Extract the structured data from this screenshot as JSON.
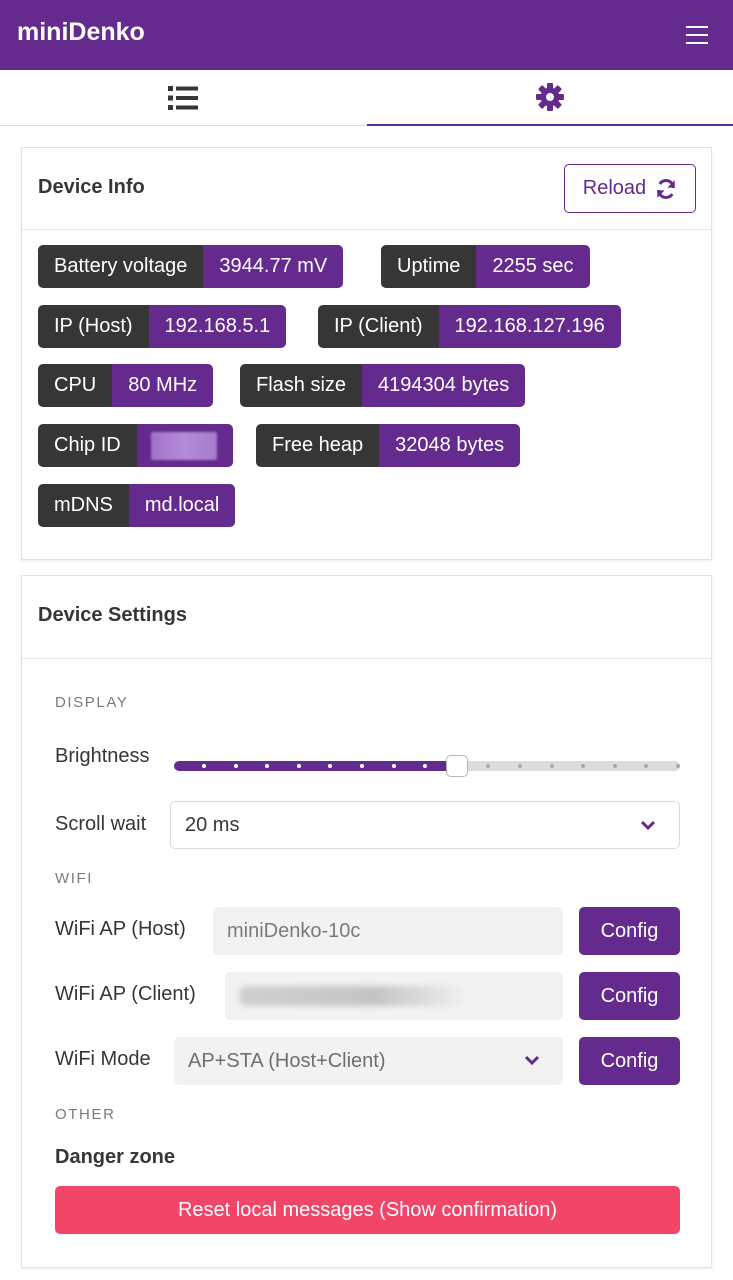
{
  "navbar": {
    "brand": "miniDenko",
    "menu_icon": "hamburger-menu-icon"
  },
  "tabs": [
    {
      "icon": "list-icon",
      "active": false
    },
    {
      "icon": "gear-icon",
      "active": true
    }
  ],
  "device_info": {
    "title": "Device Info",
    "reload_label": "Reload",
    "reload_icon": "refresh-icon",
    "items": [
      {
        "key": "Battery voltage",
        "value": "3944.77 mV"
      },
      {
        "key": "Uptime",
        "value": "2255 sec"
      },
      {
        "key": "IP (Host)",
        "value": "192.168.5.1"
      },
      {
        "key": "IP (Client)",
        "value": "192.168.127.196"
      },
      {
        "key": "CPU",
        "value": "80 MHz"
      },
      {
        "key": "Flash size",
        "value": "4194304 bytes"
      },
      {
        "key": "Chip ID",
        "value": ""
      },
      {
        "key": "Free heap",
        "value": "32048 bytes"
      },
      {
        "key": "mDNS",
        "value": "md.local"
      }
    ]
  },
  "device_settings": {
    "title": "Device Settings",
    "display": {
      "section": "DISPLAY",
      "brightness_label": "Brightness",
      "brightness_level": 0.56,
      "scroll_wait_label": "Scroll wait",
      "scroll_wait_value": "20 ms"
    },
    "wifi": {
      "section": "WIFI",
      "ap_host_label": "WiFi AP (Host)",
      "ap_host_value": "miniDenko-10c",
      "ap_client_label": "WiFi AP (Client)",
      "ap_client_value": "",
      "mode_label": "WiFi Mode",
      "mode_value": "AP+STA (Host+Client)",
      "config_label": "Config"
    },
    "other": {
      "section": "OTHER",
      "danger_title": "Danger zone",
      "reset_label": "Reset local messages (Show confirmation)"
    }
  },
  "colors": {
    "primary": "#652a8d",
    "dark": "#363636",
    "danger": "#f14668"
  }
}
